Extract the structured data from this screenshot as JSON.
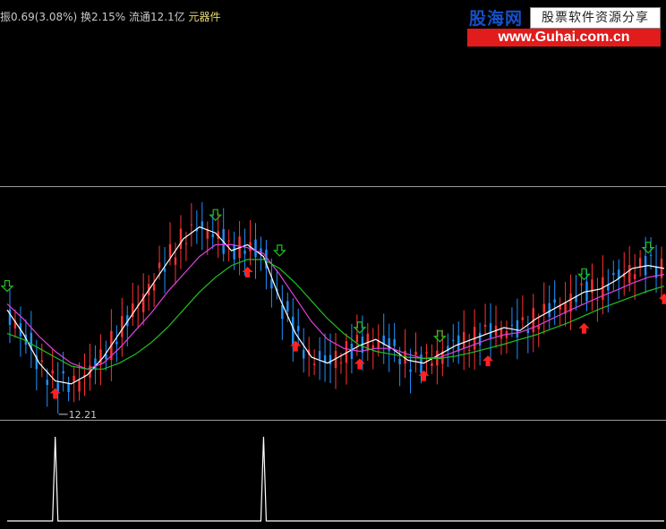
{
  "header": {
    "info_text": "振0.69(3.08%) 换2.15% 流通12.1亿",
    "category": "元器件"
  },
  "logo": {
    "brand": "股海网",
    "slogan": "股票软件资源分享",
    "url": "www.Guhai.com.cn"
  },
  "colors": {
    "background": "#000000",
    "bull": "#ff3232",
    "bear": "#1e90ff",
    "ma_fast": "#ffffff",
    "ma_mid": "#e040e0",
    "ma_slow": "#20c020",
    "buy_arrow": "#ff2020",
    "sell_arrow": "#20c020",
    "indicator": "#ffffff"
  },
  "chart_data": [
    {
      "type": "line",
      "title": "",
      "xlabel": "",
      "ylabel": "",
      "grid": false,
      "annotations": [
        {
          "text": "12.21",
          "kind": "low_price_label"
        }
      ],
      "series": [
        {
          "values": [
            13.6,
            13.2,
            12.7,
            12.4,
            12.35,
            12.5,
            12.8,
            13.2,
            13.6,
            14.0,
            14.4,
            14.8,
            15.0,
            14.9,
            14.6,
            14.7,
            14.5,
            13.8,
            13.2,
            12.8,
            12.7,
            12.85,
            13.0,
            13.1,
            12.95,
            12.75,
            12.7,
            12.85,
            13.0,
            13.1,
            13.2,
            13.3,
            13.25,
            13.45,
            13.6,
            13.75,
            13.9,
            13.95,
            14.1,
            14.3,
            14.35,
            14.3
          ]
        },
        {
          "values": [
            13.7,
            13.45,
            13.15,
            12.9,
            12.7,
            12.6,
            12.7,
            12.95,
            13.25,
            13.55,
            13.9,
            14.2,
            14.5,
            14.7,
            14.7,
            14.65,
            14.55,
            14.2,
            13.8,
            13.4,
            13.1,
            12.95,
            12.9,
            12.95,
            12.95,
            12.85,
            12.78,
            12.8,
            12.9,
            13.0,
            13.1,
            13.18,
            13.22,
            13.32,
            13.45,
            13.58,
            13.7,
            13.82,
            13.93,
            14.05,
            14.15,
            14.2
          ]
        },
        {
          "values": [
            13.2,
            13.1,
            12.95,
            12.8,
            12.65,
            12.6,
            12.6,
            12.7,
            12.85,
            13.05,
            13.3,
            13.6,
            13.9,
            14.15,
            14.35,
            14.45,
            14.45,
            14.3,
            14.05,
            13.75,
            13.45,
            13.2,
            13.0,
            12.9,
            12.85,
            12.8,
            12.78,
            12.78,
            12.82,
            12.88,
            12.95,
            13.02,
            13.1,
            13.18,
            13.28,
            13.38,
            13.5,
            13.62,
            13.72,
            13.82,
            13.92,
            14.0
          ]
        }
      ],
      "signals": {
        "buy": [
          3,
          15,
          18,
          22,
          26,
          30,
          36,
          41
        ],
        "sell": [
          0,
          13,
          17,
          22,
          27,
          36,
          40
        ]
      }
    },
    {
      "type": "line",
      "title": "",
      "series": [
        {
          "values": [
            0,
            0,
            0,
            1,
            0,
            0,
            0,
            0,
            0,
            0,
            0,
            0,
            0,
            0,
            0,
            0,
            1,
            0,
            0,
            0,
            0,
            0,
            0,
            0,
            0,
            0,
            0,
            0,
            0,
            0,
            0,
            0,
            0,
            0,
            0,
            0,
            0,
            0,
            0,
            0,
            0,
            0
          ]
        }
      ]
    }
  ]
}
